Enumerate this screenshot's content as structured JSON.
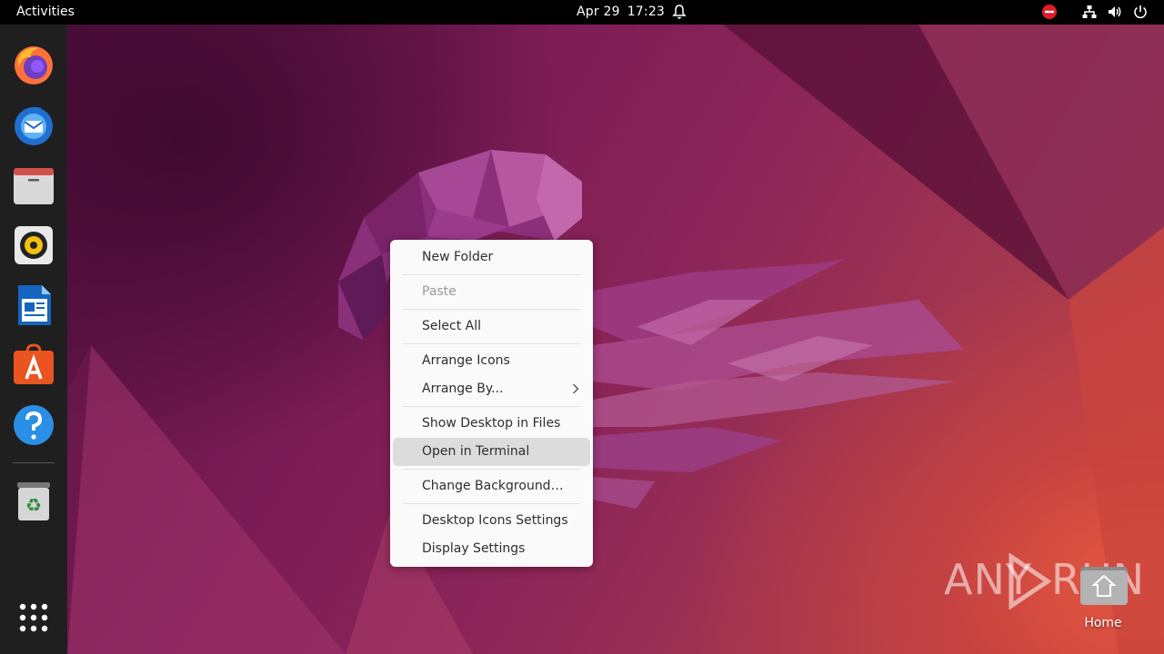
{
  "topbar": {
    "activities": "Activities",
    "date": "Apr 29",
    "time": "17:23",
    "icons": [
      "bell-icon",
      "do-not-disturb-icon",
      "network-icon",
      "volume-icon",
      "power-icon"
    ]
  },
  "dock": {
    "items": [
      "firefox-icon",
      "thunderbird-icon",
      "files-icon",
      "rhythmbox-icon",
      "libreoffice-writer-icon",
      "app-center-icon",
      "help-icon",
      "trash-icon",
      "show-apps-icon"
    ]
  },
  "context_menu": {
    "items": [
      {
        "label": "New Folder",
        "enabled": true
      },
      {
        "label": "Paste",
        "enabled": false
      },
      {
        "label": "Select All",
        "enabled": true
      },
      {
        "label": "Arrange Icons",
        "enabled": true
      },
      {
        "label": "Arrange By...",
        "enabled": true,
        "submenu": true
      },
      {
        "label": "Show Desktop in Files",
        "enabled": true
      },
      {
        "label": "Open in Terminal",
        "enabled": true,
        "highlighted": true
      },
      {
        "label": "Change Background…",
        "enabled": true
      },
      {
        "label": "Desktop Icons Settings",
        "enabled": true
      },
      {
        "label": "Display Settings",
        "enabled": true
      }
    ]
  },
  "desktop": {
    "home_label": "Home"
  },
  "watermark": {
    "left": "ANY",
    "right": "RUN"
  },
  "colors": {
    "topbar": "#000000",
    "dock": "#1f1f1f",
    "menu_bg": "#fafafa",
    "menu_highlight": "#dcdcdc"
  }
}
